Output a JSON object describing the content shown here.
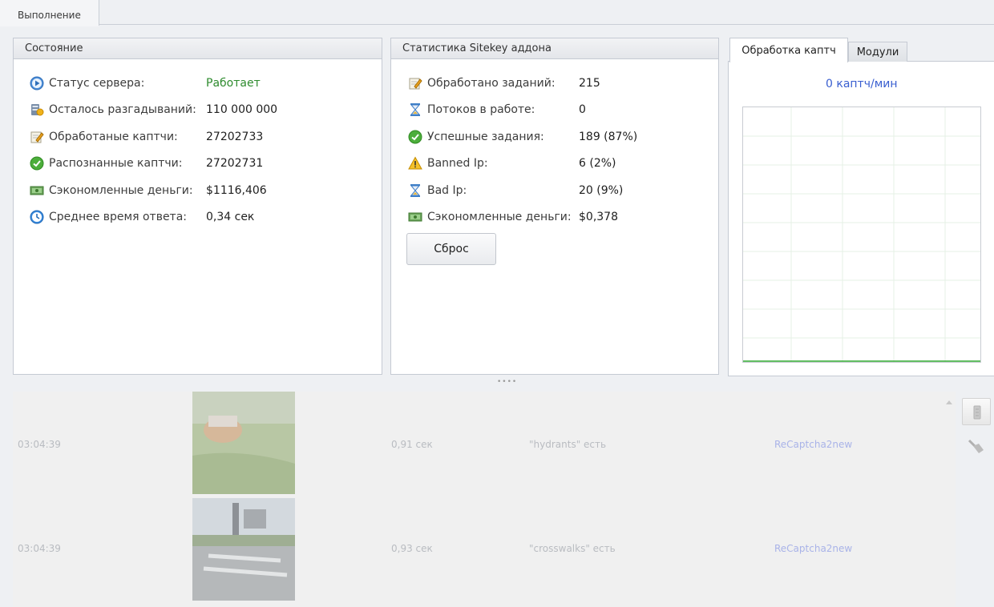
{
  "top_tab": "Выполнение",
  "status_panel": {
    "title": "Состояние",
    "rows": [
      {
        "icon": "play-circle-icon",
        "label": "Статус сервера:",
        "value": "Работает"
      },
      {
        "icon": "coins-icon",
        "label": "Осталось разгадываний:",
        "value": "110 000 000"
      },
      {
        "icon": "edit-note-icon",
        "label": "Обработаные каптчи:",
        "value": "27202733"
      },
      {
        "icon": "check-circle-icon",
        "label": "Распознанные каптчи:",
        "value": "27202731"
      },
      {
        "icon": "money-icon",
        "label": "Сэкономленные деньги:",
        "value": "$1116,406"
      },
      {
        "icon": "clock-icon",
        "label": "Среднее время ответа:",
        "value": "0,34 сек"
      }
    ]
  },
  "stats_panel": {
    "title": "Статистика Sitekey аддона",
    "rows": [
      {
        "icon": "edit-note-icon",
        "label": "Обработано заданий:",
        "value": "215"
      },
      {
        "icon": "hourglass-icon",
        "label": "Потоков в работе:",
        "value": "0"
      },
      {
        "icon": "check-circle-icon",
        "label": "Успешные задания:",
        "value": "189 (87%)"
      },
      {
        "icon": "warning-icon",
        "label": "Banned Ip:",
        "value": "6 (2%)"
      },
      {
        "icon": "hourglass-icon",
        "label": "Bad Ip:",
        "value": "20 (9%)"
      },
      {
        "icon": "money-icon",
        "label": "Сэкономленные деньги:",
        "value": "$0,378"
      }
    ],
    "reset_label": "Сброс"
  },
  "right_panel": {
    "tabs": [
      "Обработка каптч",
      "Модули"
    ],
    "rate_text": "0 каптч/мин"
  },
  "log": {
    "rows": [
      {
        "time": "03:04:39",
        "duration": "0,91 сек",
        "answer": "\"hydrants\" есть",
        "module": "ReCaptcha2new"
      },
      {
        "time": "03:04:39",
        "duration": "0,93 сек",
        "answer": "\"crosswalks\" есть",
        "module": "ReCaptcha2new"
      }
    ]
  },
  "colors": {
    "running_status": "#2e8b2e",
    "rate_text": "#3a5fd0",
    "module_link": "#a9b3e8"
  }
}
